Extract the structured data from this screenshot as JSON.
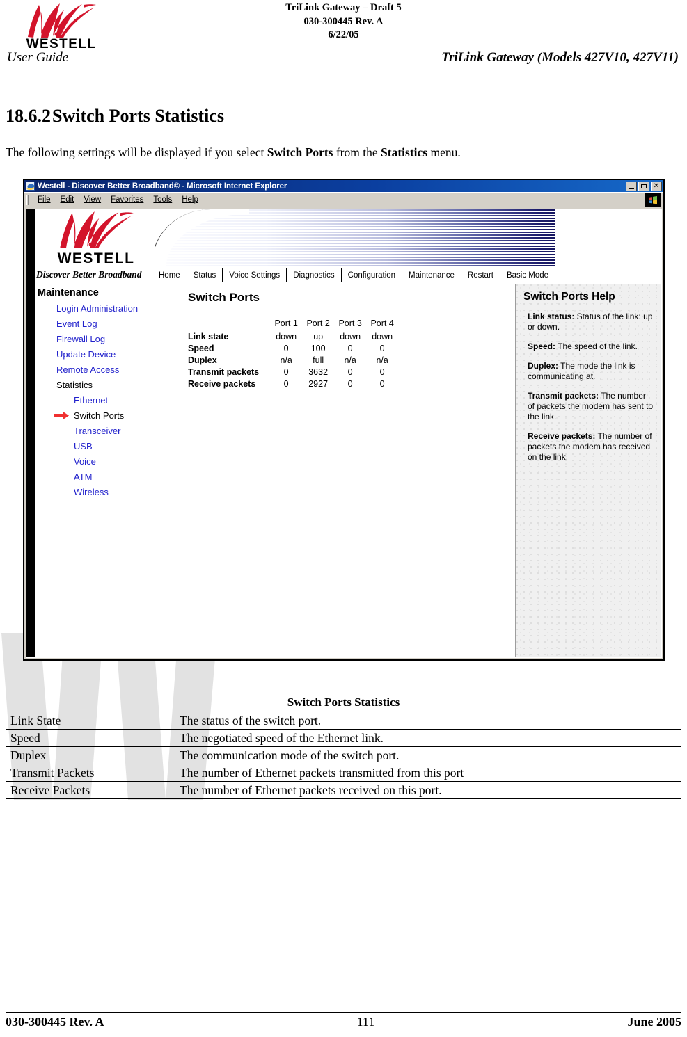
{
  "doc_header": {
    "logo_word": "WESTELL",
    "title_lines": [
      "TriLink Gateway – Draft 5",
      "030-300445 Rev. A",
      "6/22/05"
    ],
    "left_label": "User Guide",
    "right_label": "TriLink Gateway (Models 427V10, 427V11)"
  },
  "section": {
    "number": "18.6.2",
    "heading": "Switch Ports Statistics",
    "intro_pre": "The following settings will be displayed if you select ",
    "intro_bold1": "Switch Ports",
    "intro_mid": " from the ",
    "intro_bold2": "Statistics",
    "intro_post": " menu."
  },
  "browser": {
    "title": "Westell - Discover Better Broadband© - Microsoft Internet Explorer",
    "menus": [
      "File",
      "Edit",
      "View",
      "Favorites",
      "Tools",
      "Help"
    ],
    "window_buttons": [
      "minimize",
      "maximize",
      "close"
    ]
  },
  "site": {
    "logo_word": "WESTELL",
    "tagline": "Discover Better Broadband",
    "tabs": [
      "Home",
      "Status",
      "Voice Settings",
      "Diagnostics",
      "Configuration",
      "Maintenance",
      "Restart",
      "Basic Mode"
    ]
  },
  "sidebar": {
    "heading": "Maintenance",
    "items": [
      {
        "label": "Login Administration",
        "level": 1,
        "selected": false,
        "link": true
      },
      {
        "label": "Event Log",
        "level": 1,
        "selected": false,
        "link": true
      },
      {
        "label": "Firewall Log",
        "level": 1,
        "selected": false,
        "link": true
      },
      {
        "label": "Update Device",
        "level": 1,
        "selected": false,
        "link": true
      },
      {
        "label": "Remote Access",
        "level": 1,
        "selected": false,
        "link": true
      },
      {
        "label": "Statistics",
        "level": 1,
        "selected": false,
        "link": false
      },
      {
        "label": "Ethernet",
        "level": 2,
        "selected": false,
        "link": true
      },
      {
        "label": "Switch Ports",
        "level": 2,
        "selected": true,
        "link": false
      },
      {
        "label": "Transceiver",
        "level": 2,
        "selected": false,
        "link": true
      },
      {
        "label": "USB",
        "level": 2,
        "selected": false,
        "link": true
      },
      {
        "label": "Voice",
        "level": 2,
        "selected": false,
        "link": true
      },
      {
        "label": "ATM",
        "level": 2,
        "selected": false,
        "link": true
      },
      {
        "label": "Wireless",
        "level": 2,
        "selected": false,
        "link": true
      }
    ]
  },
  "main": {
    "title": "Switch Ports",
    "columns": [
      "Port 1",
      "Port 2",
      "Port 3",
      "Port 4"
    ],
    "rows": [
      {
        "label": "Link state",
        "values": [
          "down",
          "up",
          "down",
          "down"
        ]
      },
      {
        "label": "Speed",
        "values": [
          "0",
          "100",
          "0",
          "0"
        ]
      },
      {
        "label": "Duplex",
        "values": [
          "n/a",
          "full",
          "n/a",
          "n/a"
        ]
      },
      {
        "label": "Transmit packets",
        "values": [
          "0",
          "3632",
          "0",
          "0"
        ]
      },
      {
        "label": "Receive packets",
        "values": [
          "0",
          "2927",
          "0",
          "0"
        ]
      }
    ]
  },
  "help": {
    "title": "Switch Ports Help",
    "items": [
      {
        "term": "Link status:",
        "text": " Status of the link: up or down."
      },
      {
        "term": "Speed:",
        "text": " The speed of the link."
      },
      {
        "term": "Duplex:",
        "text": " The mode the link is communicating at."
      },
      {
        "term": "Transmit packets:",
        "text": " The number of packets the modem has sent to the link."
      },
      {
        "term": "Receive packets:",
        "text": " The number of packets the modem has received on the link."
      }
    ]
  },
  "def_table": {
    "caption": "Switch Ports Statistics",
    "rows": [
      {
        "term": "Link State",
        "definition": "The status of the switch port."
      },
      {
        "term": "Speed",
        "definition": "The negotiated speed of the Ethernet link."
      },
      {
        "term": "Duplex",
        "definition": "The communication mode of the switch port."
      },
      {
        "term": "Transmit Packets",
        "definition": "The number of Ethernet packets transmitted from this port"
      },
      {
        "term": "Receive Packets",
        "definition": "The number of Ethernet packets received on this port."
      }
    ]
  },
  "footer": {
    "left": "030-300445 Rev. A",
    "center": "111",
    "right": "June 2005"
  },
  "colors": {
    "brand_red": "#d3142b",
    "link_blue": "#2222cc",
    "banner_navy": "#161660",
    "title_blue": "#0a246a"
  }
}
